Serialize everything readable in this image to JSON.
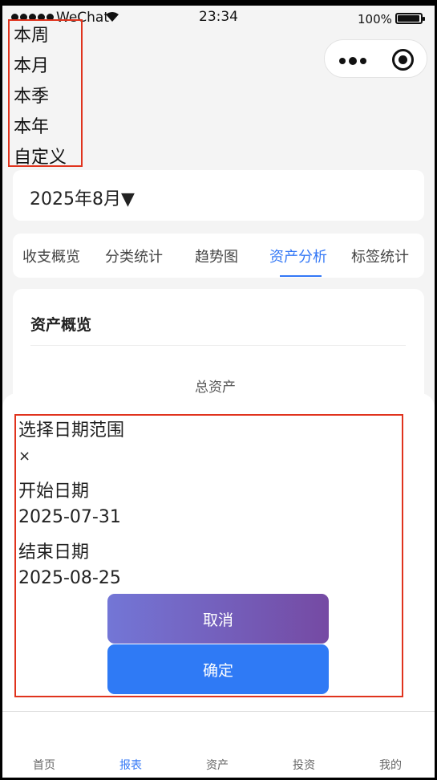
{
  "status_bar": {
    "carrier": "WeChat",
    "time": "23:34",
    "battery": "100%"
  },
  "range_options": [
    "本周",
    "本月",
    "本季",
    "本年",
    "自定义"
  ],
  "month_selector": {
    "label": "2025年8月▼"
  },
  "tabs": [
    {
      "label": "收支概览",
      "active": false
    },
    {
      "label": "分类统计",
      "active": false
    },
    {
      "label": "趋势图",
      "active": false
    },
    {
      "label": "资产分析",
      "active": true
    },
    {
      "label": "标签统计",
      "active": false
    }
  ],
  "overview": {
    "title": "资产概览",
    "total_label": "总资产"
  },
  "date_sheet": {
    "title": "选择日期范围",
    "close": "×",
    "start_label": "开始日期",
    "start_value": "2025-07-31",
    "end_label": "结束日期",
    "end_value": "2025-08-25",
    "cancel": "取消",
    "confirm": "确定"
  },
  "tabbar": [
    {
      "label": "首页",
      "active": false
    },
    {
      "label": "报表",
      "active": true
    },
    {
      "label": "资产",
      "active": false
    },
    {
      "label": "投资",
      "active": false
    },
    {
      "label": "我的",
      "active": false
    }
  ],
  "colors": {
    "accent": "#3478f6",
    "highlight_border": "#e0331d",
    "cancel_gradient_start": "#7376d6",
    "cancel_gradient_end": "#754aa3",
    "confirm": "#2f7af5"
  }
}
